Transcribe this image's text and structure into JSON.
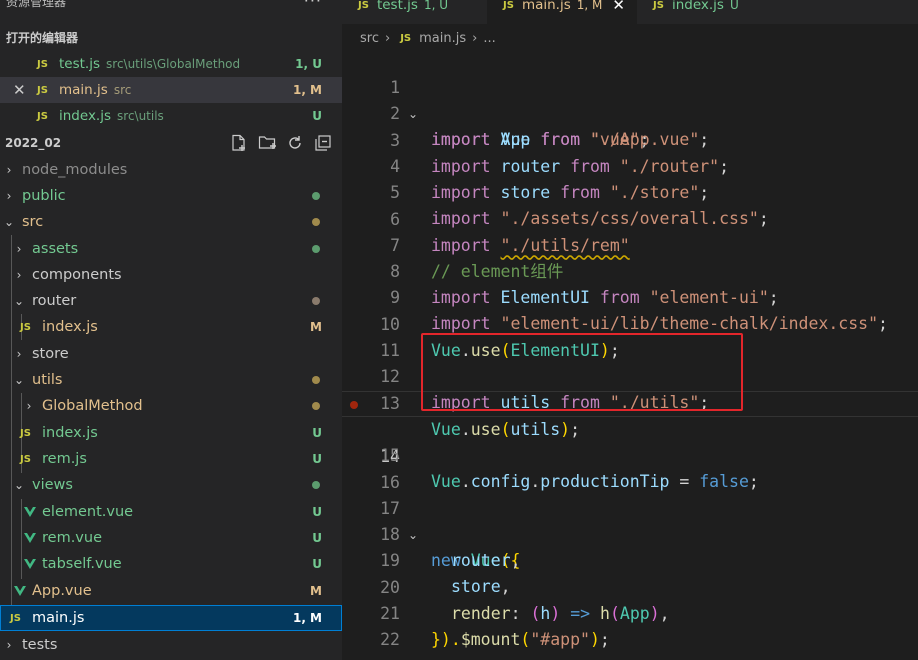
{
  "sidebar": {
    "title": "资源管理器",
    "more": "···",
    "open_editors": {
      "title": "打开的编辑器",
      "items": [
        {
          "name": "test.js",
          "path": "src\\utils\\GlobalMethod",
          "status": "1, U",
          "badge": "JS"
        },
        {
          "name": "main.js",
          "path": "src",
          "status": "1, M",
          "badge": "JS",
          "close": "✕"
        },
        {
          "name": "index.js",
          "path": "src\\utils",
          "status": "U",
          "badge": "JS"
        }
      ]
    },
    "project": {
      "name": "2022_02",
      "actions": [
        "new-file-icon",
        "new-folder-icon",
        "refresh-icon",
        "collapse-all-icon"
      ]
    },
    "tree": [
      {
        "label": "node_modules",
        "chevron": "›"
      },
      {
        "label": "public",
        "chevron": "›"
      },
      {
        "label": "src",
        "chevron": "⌄"
      },
      {
        "label": "assets",
        "chevron": "›"
      },
      {
        "label": "components",
        "chevron": "›"
      },
      {
        "label": "router",
        "chevron": "⌄"
      },
      {
        "label": "index.js",
        "badge": "JS",
        "status": "M"
      },
      {
        "label": "store",
        "chevron": "›"
      },
      {
        "label": "utils",
        "chevron": "⌄"
      },
      {
        "label": "GlobalMethod",
        "chevron": "›"
      },
      {
        "label": "index.js",
        "badge": "JS",
        "status": "U"
      },
      {
        "label": "rem.js",
        "badge": "JS",
        "status": "U"
      },
      {
        "label": "views",
        "chevron": "⌄"
      },
      {
        "label": "element.vue",
        "status": "U"
      },
      {
        "label": "rem.vue",
        "status": "U"
      },
      {
        "label": "tabself.vue",
        "status": "U"
      },
      {
        "label": "App.vue",
        "status": "M"
      },
      {
        "label": "main.js",
        "badge": "JS",
        "status": "1, M"
      },
      {
        "label": "tests",
        "chevron": "›"
      }
    ]
  },
  "tabs": [
    {
      "badge": "JS",
      "name": "test.js",
      "status": "1, U"
    },
    {
      "badge": "JS",
      "name": "main.js",
      "status": "1, M",
      "close": "✕"
    },
    {
      "badge": "JS",
      "name": "index.js",
      "status": "U"
    }
  ],
  "breadcrumb": {
    "folder": "src",
    "sep": "›",
    "badge": "JS",
    "file": "main.js",
    "more": "..."
  },
  "editor": {
    "line_numbers": [
      "1",
      "2",
      "3",
      "4",
      "5",
      "6",
      "7",
      "8",
      "9",
      "10",
      "11",
      "12",
      "13",
      "14",
      "15",
      "16",
      "17",
      "18",
      "19",
      "20",
      "21",
      "22"
    ],
    "fold_marker": "⌄",
    "code": {
      "kw_import": "import",
      "kw_from": "from",
      "vue": "Vue",
      "app": "App",
      "router": "router",
      "store": "store",
      "element_ui": "ElementUI",
      "utils": "utils",
      "s_vue": "\"vue\"",
      "s_app": "\"./App.vue\"",
      "s_router": "\"./router\"",
      "s_store": "\"./store\"",
      "s_css": "\"./assets/css/overall.css\"",
      "s_rem": "\"./utils/rem\"",
      "comment": "// element组件",
      "s_eui": "\"element-ui\"",
      "s_theme": "\"element-ui/lib/theme-chalk/index.css\"",
      "s_utils": "\"./utils\"",
      "dot": ".",
      "use": "use",
      "lparen": "(",
      "rparen": ")",
      "semi": ";",
      "config": "config",
      "production_tip": "productionTip",
      "eq": " = ",
      "kw_false": "false",
      "kw_new": "new",
      "brace_open": "({",
      "render": "render",
      "h": "h",
      "arrow": "=>",
      "mount_close": "}).",
      "mount": "$mount",
      "s_app_id": "\"#app\"",
      "comma": ",",
      "colon": ":"
    }
  }
}
